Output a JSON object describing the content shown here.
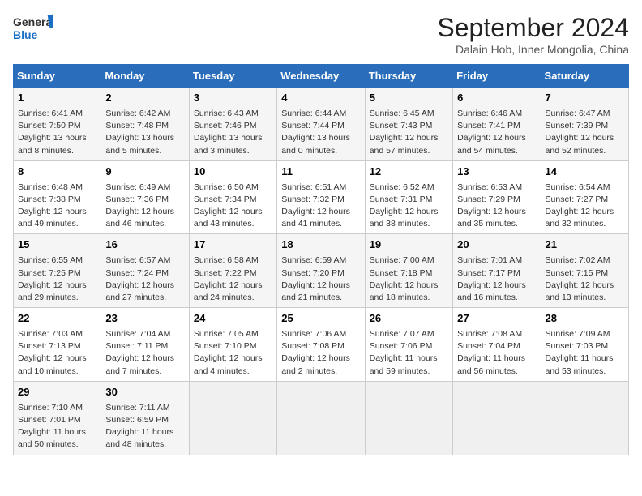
{
  "logo": {
    "line1": "General",
    "line2": "Blue"
  },
  "title": "September 2024",
  "subtitle": "Dalain Hob, Inner Mongolia, China",
  "days_of_week": [
    "Sunday",
    "Monday",
    "Tuesday",
    "Wednesday",
    "Thursday",
    "Friday",
    "Saturday"
  ],
  "weeks": [
    [
      {
        "day": "1",
        "info": "Sunrise: 6:41 AM\nSunset: 7:50 PM\nDaylight: 13 hours\nand 8 minutes."
      },
      {
        "day": "2",
        "info": "Sunrise: 6:42 AM\nSunset: 7:48 PM\nDaylight: 13 hours\nand 5 minutes."
      },
      {
        "day": "3",
        "info": "Sunrise: 6:43 AM\nSunset: 7:46 PM\nDaylight: 13 hours\nand 3 minutes."
      },
      {
        "day": "4",
        "info": "Sunrise: 6:44 AM\nSunset: 7:44 PM\nDaylight: 13 hours\nand 0 minutes."
      },
      {
        "day": "5",
        "info": "Sunrise: 6:45 AM\nSunset: 7:43 PM\nDaylight: 12 hours\nand 57 minutes."
      },
      {
        "day": "6",
        "info": "Sunrise: 6:46 AM\nSunset: 7:41 PM\nDaylight: 12 hours\nand 54 minutes."
      },
      {
        "day": "7",
        "info": "Sunrise: 6:47 AM\nSunset: 7:39 PM\nDaylight: 12 hours\nand 52 minutes."
      }
    ],
    [
      {
        "day": "8",
        "info": "Sunrise: 6:48 AM\nSunset: 7:38 PM\nDaylight: 12 hours\nand 49 minutes."
      },
      {
        "day": "9",
        "info": "Sunrise: 6:49 AM\nSunset: 7:36 PM\nDaylight: 12 hours\nand 46 minutes."
      },
      {
        "day": "10",
        "info": "Sunrise: 6:50 AM\nSunset: 7:34 PM\nDaylight: 12 hours\nand 43 minutes."
      },
      {
        "day": "11",
        "info": "Sunrise: 6:51 AM\nSunset: 7:32 PM\nDaylight: 12 hours\nand 41 minutes."
      },
      {
        "day": "12",
        "info": "Sunrise: 6:52 AM\nSunset: 7:31 PM\nDaylight: 12 hours\nand 38 minutes."
      },
      {
        "day": "13",
        "info": "Sunrise: 6:53 AM\nSunset: 7:29 PM\nDaylight: 12 hours\nand 35 minutes."
      },
      {
        "day": "14",
        "info": "Sunrise: 6:54 AM\nSunset: 7:27 PM\nDaylight: 12 hours\nand 32 minutes."
      }
    ],
    [
      {
        "day": "15",
        "info": "Sunrise: 6:55 AM\nSunset: 7:25 PM\nDaylight: 12 hours\nand 29 minutes."
      },
      {
        "day": "16",
        "info": "Sunrise: 6:57 AM\nSunset: 7:24 PM\nDaylight: 12 hours\nand 27 minutes."
      },
      {
        "day": "17",
        "info": "Sunrise: 6:58 AM\nSunset: 7:22 PM\nDaylight: 12 hours\nand 24 minutes."
      },
      {
        "day": "18",
        "info": "Sunrise: 6:59 AM\nSunset: 7:20 PM\nDaylight: 12 hours\nand 21 minutes."
      },
      {
        "day": "19",
        "info": "Sunrise: 7:00 AM\nSunset: 7:18 PM\nDaylight: 12 hours\nand 18 minutes."
      },
      {
        "day": "20",
        "info": "Sunrise: 7:01 AM\nSunset: 7:17 PM\nDaylight: 12 hours\nand 16 minutes."
      },
      {
        "day": "21",
        "info": "Sunrise: 7:02 AM\nSunset: 7:15 PM\nDaylight: 12 hours\nand 13 minutes."
      }
    ],
    [
      {
        "day": "22",
        "info": "Sunrise: 7:03 AM\nSunset: 7:13 PM\nDaylight: 12 hours\nand 10 minutes."
      },
      {
        "day": "23",
        "info": "Sunrise: 7:04 AM\nSunset: 7:11 PM\nDaylight: 12 hours\nand 7 minutes."
      },
      {
        "day": "24",
        "info": "Sunrise: 7:05 AM\nSunset: 7:10 PM\nDaylight: 12 hours\nand 4 minutes."
      },
      {
        "day": "25",
        "info": "Sunrise: 7:06 AM\nSunset: 7:08 PM\nDaylight: 12 hours\nand 2 minutes."
      },
      {
        "day": "26",
        "info": "Sunrise: 7:07 AM\nSunset: 7:06 PM\nDaylight: 11 hours\nand 59 minutes."
      },
      {
        "day": "27",
        "info": "Sunrise: 7:08 AM\nSunset: 7:04 PM\nDaylight: 11 hours\nand 56 minutes."
      },
      {
        "day": "28",
        "info": "Sunrise: 7:09 AM\nSunset: 7:03 PM\nDaylight: 11 hours\nand 53 minutes."
      }
    ],
    [
      {
        "day": "29",
        "info": "Sunrise: 7:10 AM\nSunset: 7:01 PM\nDaylight: 11 hours\nand 50 minutes."
      },
      {
        "day": "30",
        "info": "Sunrise: 7:11 AM\nSunset: 6:59 PM\nDaylight: 11 hours\nand 48 minutes."
      },
      {
        "day": "",
        "info": ""
      },
      {
        "day": "",
        "info": ""
      },
      {
        "day": "",
        "info": ""
      },
      {
        "day": "",
        "info": ""
      },
      {
        "day": "",
        "info": ""
      }
    ]
  ]
}
